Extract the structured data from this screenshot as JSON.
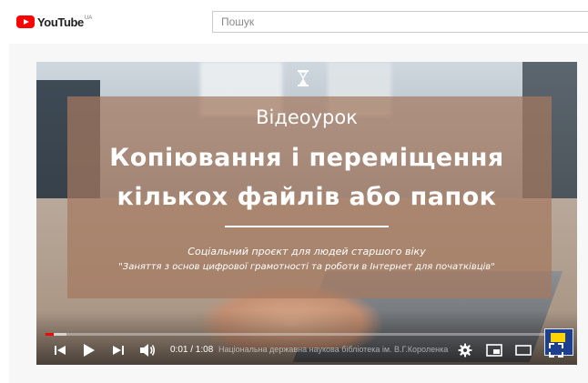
{
  "header": {
    "logo_text": "YouTube",
    "logo_region": "UA",
    "search_placeholder": "Пошук"
  },
  "video": {
    "subtitle": "Відеоурок",
    "title_line1": "Копіювання і переміщення",
    "title_line2": "кількох файлів або папок",
    "project_line": "Соціальний проєкт для людей старшого віку",
    "course_line": "\"Заняття з основ цифрової грамотності та роботи в Інтернет для початківців\"",
    "watermark": "Національна державна наукова бібліотека ім. В.Г.Короленка",
    "current_time": "0:01",
    "duration": "1:08",
    "time_display": "0:01 / 1:08",
    "progress_played_fraction": 0.015,
    "progress_loaded_fraction": 0.04
  },
  "colors": {
    "brand_red": "#ff0000",
    "overlay": "#a5785f",
    "text_light": "#ffffff"
  },
  "icons": {
    "logo": "youtube-logo-icon",
    "badge": "hourglass-icon",
    "previous": "skip-previous-icon",
    "play": "play-icon",
    "next": "skip-next-icon",
    "volume": "volume-icon",
    "settings": "gear-icon",
    "miniplayer": "miniplayer-icon",
    "theater": "theater-mode-icon",
    "fullscreen": "fullscreen-icon"
  }
}
